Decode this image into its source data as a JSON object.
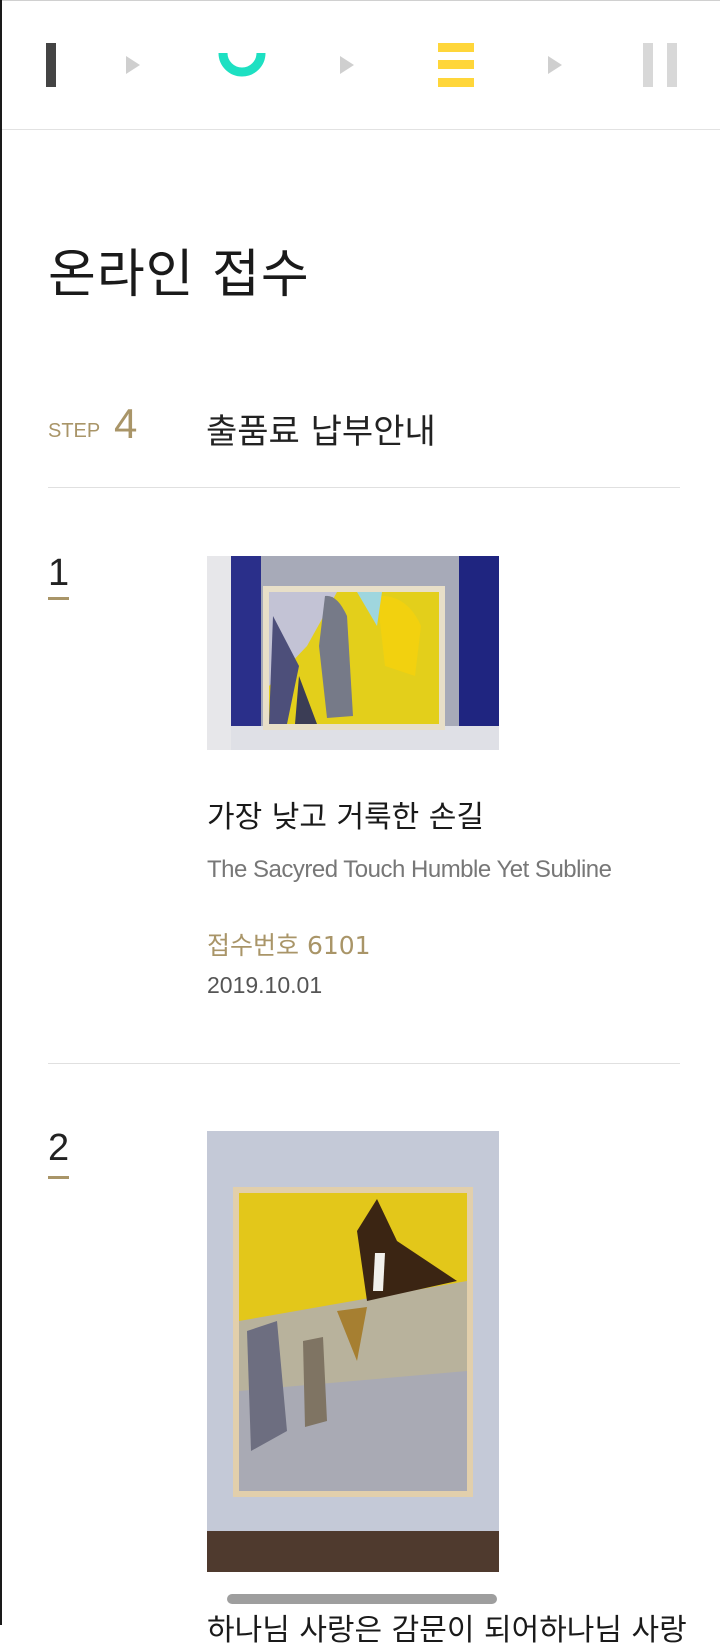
{
  "progress": {
    "steps": [
      {
        "name": "step-1",
        "state": "done",
        "color": "#444444"
      },
      {
        "name": "step-2",
        "state": "done",
        "color": "#1de0c2"
      },
      {
        "name": "step-3",
        "state": "done",
        "color": "#ffd63a"
      },
      {
        "name": "step-4",
        "state": "current",
        "color": "#d8d8d8"
      }
    ],
    "arrow_color": "#cfcfcf"
  },
  "page_title": "온라인 접수",
  "step": {
    "label": "STEP",
    "number": "4",
    "title": "출품료 납부안내"
  },
  "accent_color": "#a99568",
  "items": [
    {
      "number": "1",
      "title": "가장 낮고 거룩한 손길",
      "subtitle": "The Sacyred Touch Humble Yet Subline",
      "receipt": "접수번호 6101",
      "date": "2019.10.01"
    },
    {
      "number": "2",
      "title": "하나님 사랑은 감문이 되어하나님 사랑",
      "subtitle": "",
      "receipt": "",
      "date": ""
    }
  ]
}
